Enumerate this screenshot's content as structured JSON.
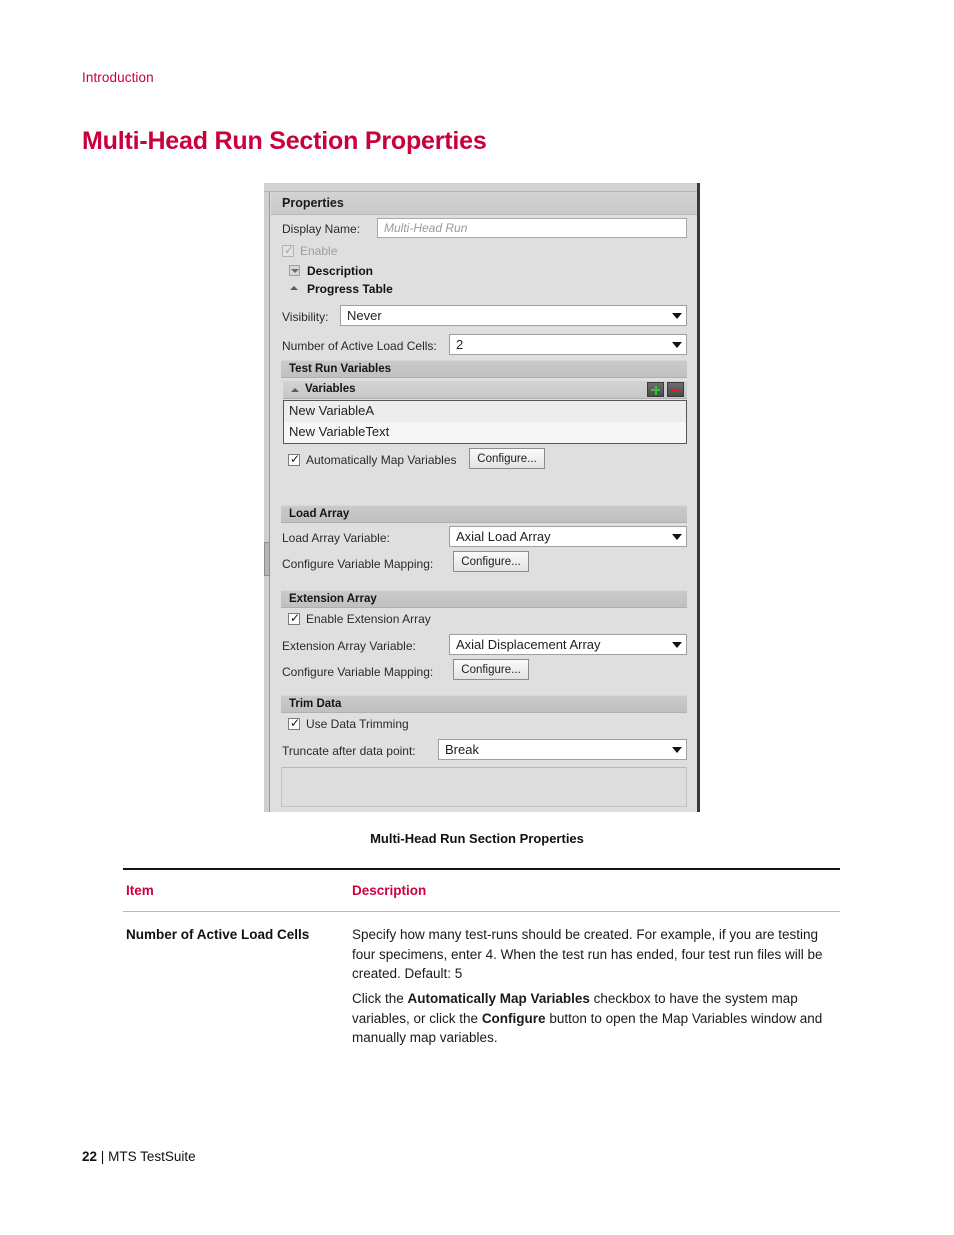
{
  "page": {
    "running_head": "Introduction",
    "title": "Multi-Head Run Section Properties",
    "footer_page_number": "22",
    "footer_separator": "|",
    "footer_product": "MTS TestSuite",
    "accent_color": "#c8003c",
    "heading_color": "#d1003f"
  },
  "figure": {
    "caption": "Multi-Head Run Section Properties",
    "panel": {
      "header": "Properties",
      "display_name": {
        "label": "Display Name:",
        "value": "Multi-Head Run"
      },
      "enable": {
        "label": "Enable",
        "checked": true,
        "disabled": true
      },
      "description": {
        "label": "Description",
        "state": "collapsed"
      },
      "progress_table": {
        "label": "Progress Table",
        "state": "expanded"
      },
      "visibility": {
        "label": "Visibility:",
        "value": "Never"
      },
      "active_load_cells": {
        "label": "Number of Active Load Cells:",
        "value": "2"
      },
      "test_run_variables": {
        "band_label": "Test Run Variables",
        "variables_label": "Variables",
        "add_icon": "plus-icon",
        "remove_icon": "minus-icon",
        "items": [
          "New VariableA",
          "New VariableText"
        ],
        "auto_map": {
          "label": "Automatically Map Variables",
          "checked": true
        },
        "configure_button": "Configure..."
      },
      "load_array": {
        "band_label": "Load Array",
        "variable_label": "Load Array Variable:",
        "variable_value": "Axial Load Array",
        "mapping_label": "Configure Variable Mapping:",
        "configure_button": "Configure..."
      },
      "extension_array": {
        "band_label": "Extension Array",
        "enable_label": "Enable Extension Array",
        "enable_checked": true,
        "variable_label": "Extension Array Variable:",
        "variable_value": "Axial Displacement Array",
        "mapping_label": "Configure Variable Mapping:",
        "configure_button": "Configure..."
      },
      "trim_data": {
        "band_label": "Trim Data",
        "use_trimming_label": "Use Data Trimming",
        "use_trimming_checked": true,
        "truncate_label": "Truncate after data point:",
        "truncate_value": "Break"
      }
    }
  },
  "table": {
    "headers": {
      "item": "Item",
      "description": "Description"
    },
    "rows": [
      {
        "item": "Number of Active Load Cells",
        "paragraph_1": "Specify how many test-runs should be created. For example, if you are testing four specimens, enter 4. When the test run has ended, four test run files will be created. Default: 5",
        "paragraph_2_parts": {
          "a": "Click the ",
          "b_bold": "Automatically Map Variables",
          "c": " checkbox to have the system map variables, or click the ",
          "d_bold": "Configure",
          "e": " button to open the Map Variables window and manually map variables."
        }
      }
    ]
  }
}
